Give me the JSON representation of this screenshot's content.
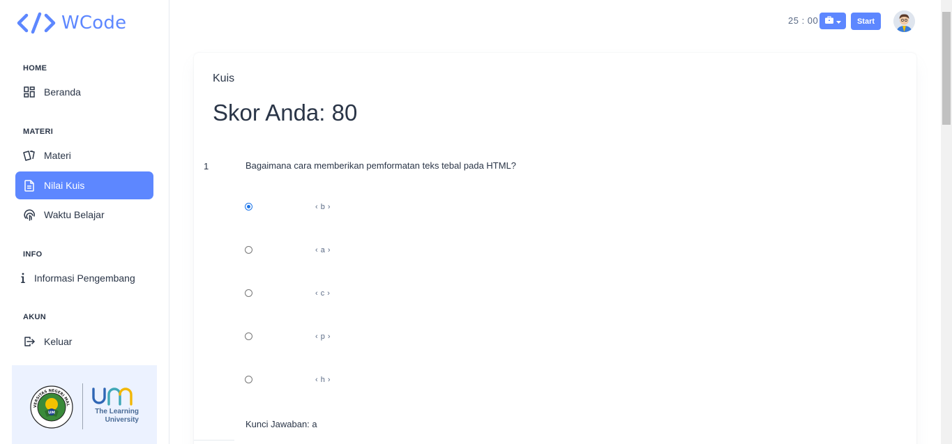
{
  "brand": {
    "name": "WCode",
    "icon": "code-brackets-icon"
  },
  "sidebar": {
    "sections": [
      {
        "caption": "HOME",
        "items": [
          {
            "label": "Beranda",
            "icon": "dashboard-icon"
          }
        ]
      },
      {
        "caption": "MATERI",
        "items": [
          {
            "label": "Materi",
            "icon": "cards-icon"
          },
          {
            "label": "Nilai Kuis",
            "icon": "file-text-icon",
            "active": true
          },
          {
            "label": "Waktu Belajar",
            "icon": "fingerprint-icon"
          }
        ]
      },
      {
        "caption": "INFO",
        "items": [
          {
            "label": "Informasi Pengembang",
            "icon": "info-icon"
          }
        ]
      },
      {
        "caption": "AKUN",
        "items": [
          {
            "label": "Keluar",
            "icon": "logout-icon"
          }
        ]
      }
    ],
    "university": {
      "tagline_line1": "The Learning",
      "tagline_line2": "University",
      "seal_text": "UNIVERSITAS NEGERI MALANG",
      "seal_mark": "UM"
    }
  },
  "header": {
    "timer": "25 : 00",
    "start_label": "Start",
    "tools_icon": "briefcase-icon"
  },
  "main": {
    "title": "Kuis",
    "score_text": "Skor Anda: 80",
    "question": {
      "number": "1",
      "text": "Bagaimana cara memberikan pemformatan teks tebal pada HTML?",
      "options": [
        "‹ b ›",
        "‹ a ›",
        "‹ c ›",
        "‹ p ›",
        "‹ h ›"
      ],
      "selected_index": 0
    },
    "answer_key": "Kunci Jawaban: a"
  },
  "colors": {
    "accent": "#5d87ff",
    "text": "#2a3547",
    "sidebar_logo_bg": "#ecf2ff"
  }
}
